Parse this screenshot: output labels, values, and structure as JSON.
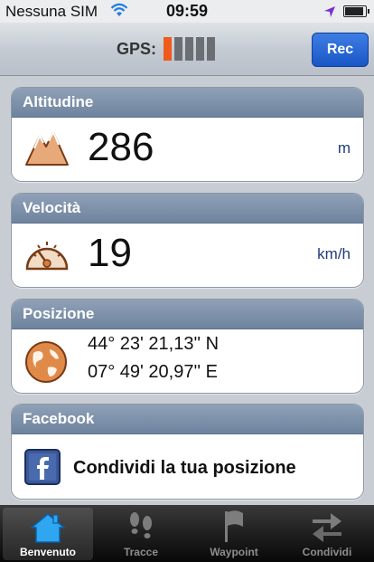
{
  "status_bar": {
    "carrier": "Nessuna SIM",
    "time": "09:59"
  },
  "navbar": {
    "gps_label": "GPS:",
    "gps_signal_bars_on": 1,
    "gps_signal_bars_total": 5,
    "rec_label": "Rec"
  },
  "altitude": {
    "title": "Altitudine",
    "value": "286",
    "unit": "m"
  },
  "speed": {
    "title": "Velocità",
    "value": "19",
    "unit": "km/h"
  },
  "position": {
    "title": "Posizione",
    "lat": "44° 23' 21,13'' N",
    "lon": "07° 49' 20,97'' E"
  },
  "facebook": {
    "title": "Facebook",
    "share_label": "Condividi la tua posizione"
  },
  "tabs": [
    {
      "label": "Benvenuto",
      "icon": "home-icon",
      "active": true
    },
    {
      "label": "Tracce",
      "icon": "footprints-icon",
      "active": false
    },
    {
      "label": "Waypoint",
      "icon": "flag-icon",
      "active": false
    },
    {
      "label": "Condividi",
      "icon": "share-arrows-icon",
      "active": false
    }
  ],
  "colors": {
    "accent_blue": "#1a56c6",
    "gps_on": "#f05a1a",
    "panel_header": "#7d91aa"
  }
}
